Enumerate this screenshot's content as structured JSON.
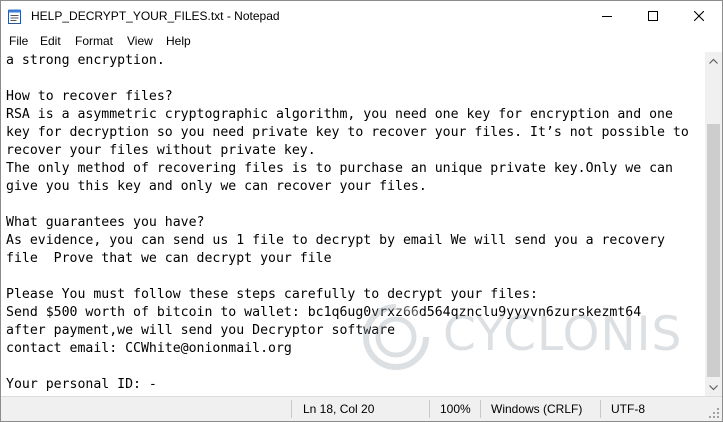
{
  "window": {
    "title": "HELP_DECRYPT_YOUR_FILES.txt - Notepad"
  },
  "menu": {
    "items": [
      "File",
      "Edit",
      "Format",
      "View",
      "Help"
    ]
  },
  "editor": {
    "lines": [
      "a strong encryption.",
      "",
      "How to recover files?",
      "RSA is a asymmetric cryptographic algorithm, you need one key for encryption and one",
      "key for decryption so you need private key to recover your files. It’s not possible to",
      "recover your files without private key.",
      "The only method of recovering files is to purchase an unique private key.Only we can",
      "give you this key and only we can recover your files.",
      "",
      "What guarantees you have?",
      "As evidence, you can send us 1 file to decrypt by email We will send you a recovery",
      "file  Prove that we can decrypt your file",
      "",
      "Please You must follow these steps carefully to decrypt your files:",
      "Send $500 worth of bitcoin to wallet: bc1q6ug0vrxz66d564qznclu9yyyvn6zurskezmt64",
      "after payment,we will send you Decryptor software",
      "contact email: CCWhite@onionmail.org",
      "",
      "Your personal ID: -"
    ]
  },
  "status": {
    "position": "Ln 18, Col 20",
    "zoom": "100%",
    "line_ending": "Windows (CRLF)",
    "encoding": "UTF-8"
  },
  "watermark": {
    "text": "CYCLONIS"
  }
}
